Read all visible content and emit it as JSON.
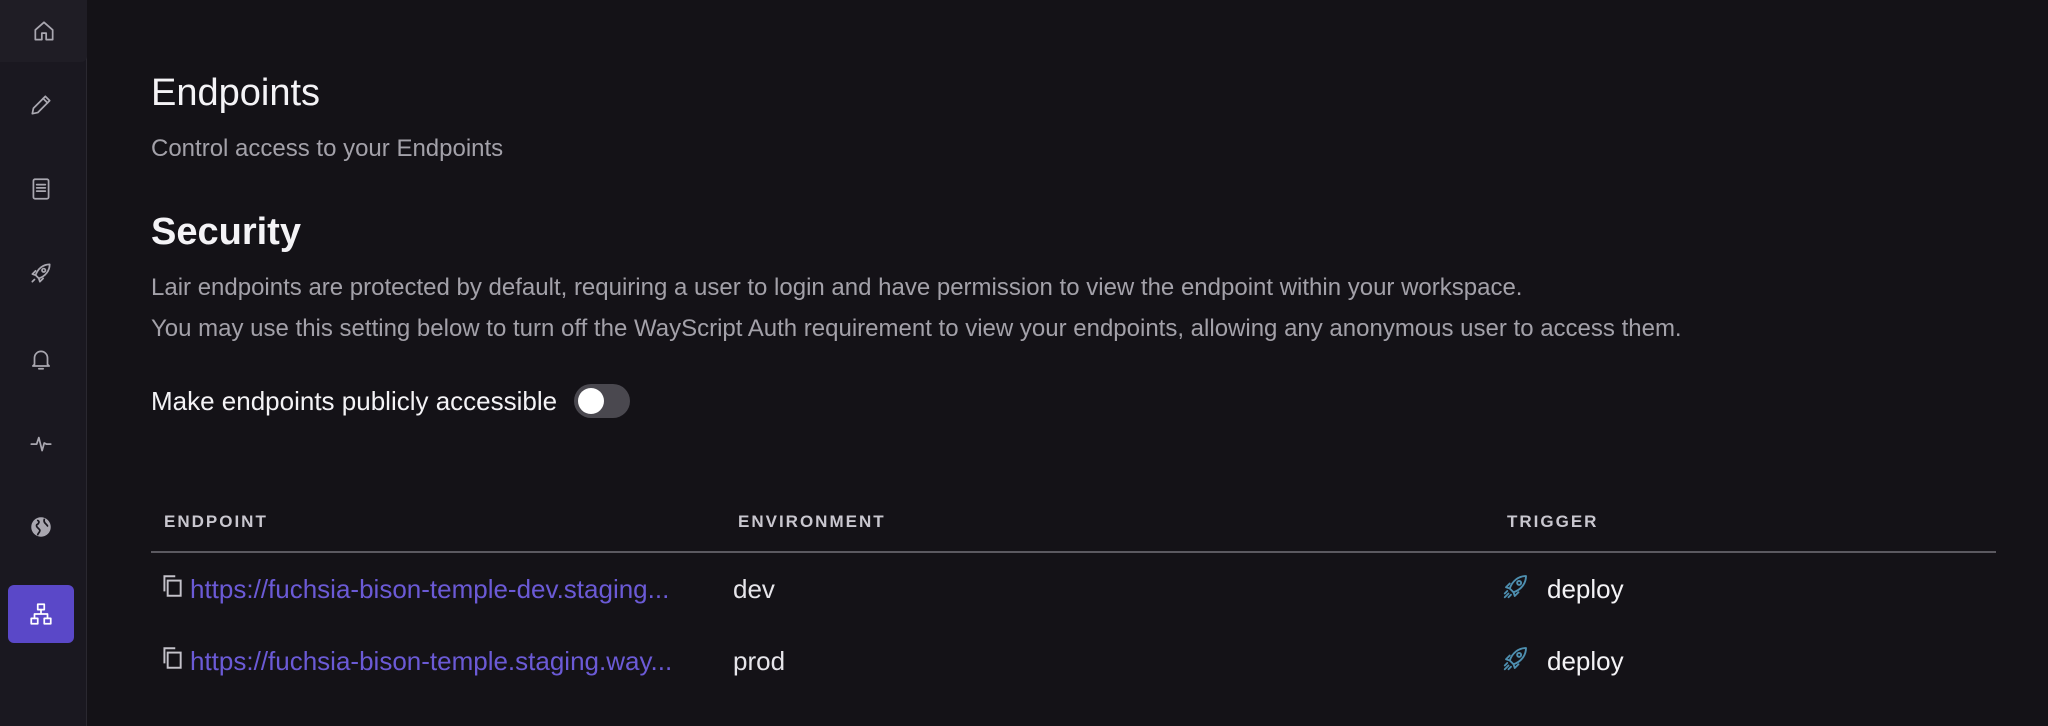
{
  "sidebar": {
    "items": [
      {
        "icon": "home-icon"
      },
      {
        "icon": "pencil-icon"
      },
      {
        "icon": "document-icon"
      },
      {
        "icon": "rocket-icon"
      },
      {
        "icon": "bell-icon"
      },
      {
        "icon": "pulse-icon"
      },
      {
        "icon": "globe-icon"
      },
      {
        "icon": "hierarchy-icon",
        "active": true
      }
    ]
  },
  "page": {
    "title": "Endpoints",
    "subtitle": "Control access to your Endpoints"
  },
  "security": {
    "title": "Security",
    "line1": "Lair endpoints are protected by default, requiring a user to login and have permission to view the endpoint within your workspace.",
    "line2": "You may use this setting below to turn off the WayScript Auth requirement to view your endpoints, allowing any anonymous user to access them.",
    "toggle_label": "Make endpoints publicly accessible",
    "toggle_on": false
  },
  "table": {
    "headers": {
      "endpoint": "ENDPOINT",
      "environment": "ENVIRONMENT",
      "trigger": "TRIGGER"
    },
    "rows": [
      {
        "endpoint": "https://fuchsia-bison-temple-dev.staging...",
        "environment": "dev",
        "trigger": "deploy"
      },
      {
        "endpoint": "https://fuchsia-bison-temple.staging.way...",
        "environment": "prod",
        "trigger": "deploy"
      }
    ]
  },
  "colors": {
    "accent": "#5a48c8",
    "link": "#6b5ad6",
    "background": "#141217"
  }
}
